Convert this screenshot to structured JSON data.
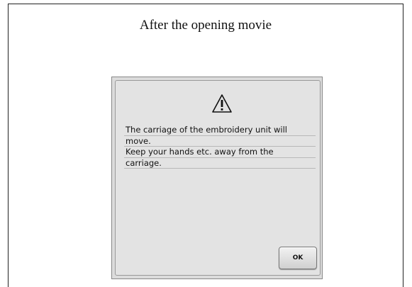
{
  "caption": "After the opening movie",
  "dialog": {
    "icon": "warning-triangle-icon",
    "message_lines": [
      "The carriage of the embroidery unit will",
      "move.",
      "Keep your hands etc. away from the",
      "carriage."
    ],
    "ok_label": "OK"
  }
}
